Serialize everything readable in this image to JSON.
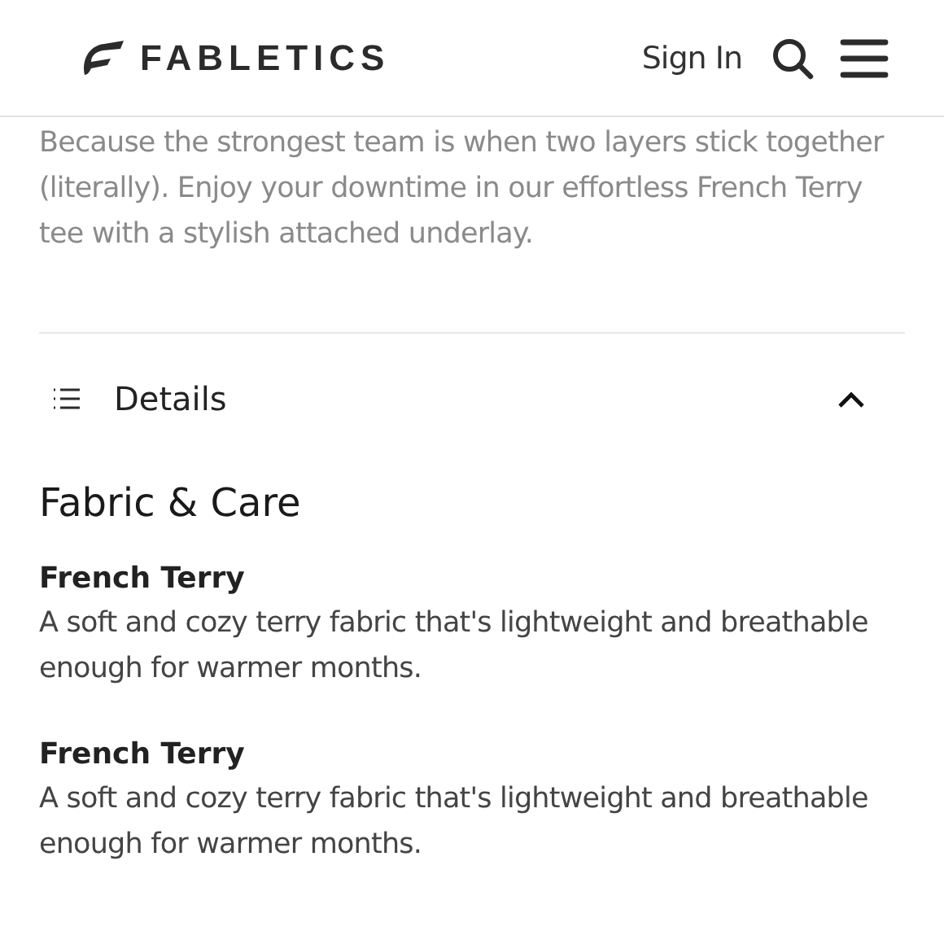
{
  "header": {
    "brand": "FABLETICS",
    "sign_in": "Sign In"
  },
  "description": "Because the strongest team is when two layers stick together (literally). Enjoy your downtime in our effortless French Terry tee with a stylish attached underlay.",
  "details": {
    "label": "Details",
    "expanded": true,
    "section_title": "Fabric & Care",
    "items": [
      {
        "title": "French Terry",
        "text": "A soft and cozy terry fabric that's lightweight and breathable enough for warmer months."
      },
      {
        "title": "French Terry",
        "text": "A soft and cozy terry fabric that's lightweight and breathable enough for warmer months."
      }
    ]
  }
}
